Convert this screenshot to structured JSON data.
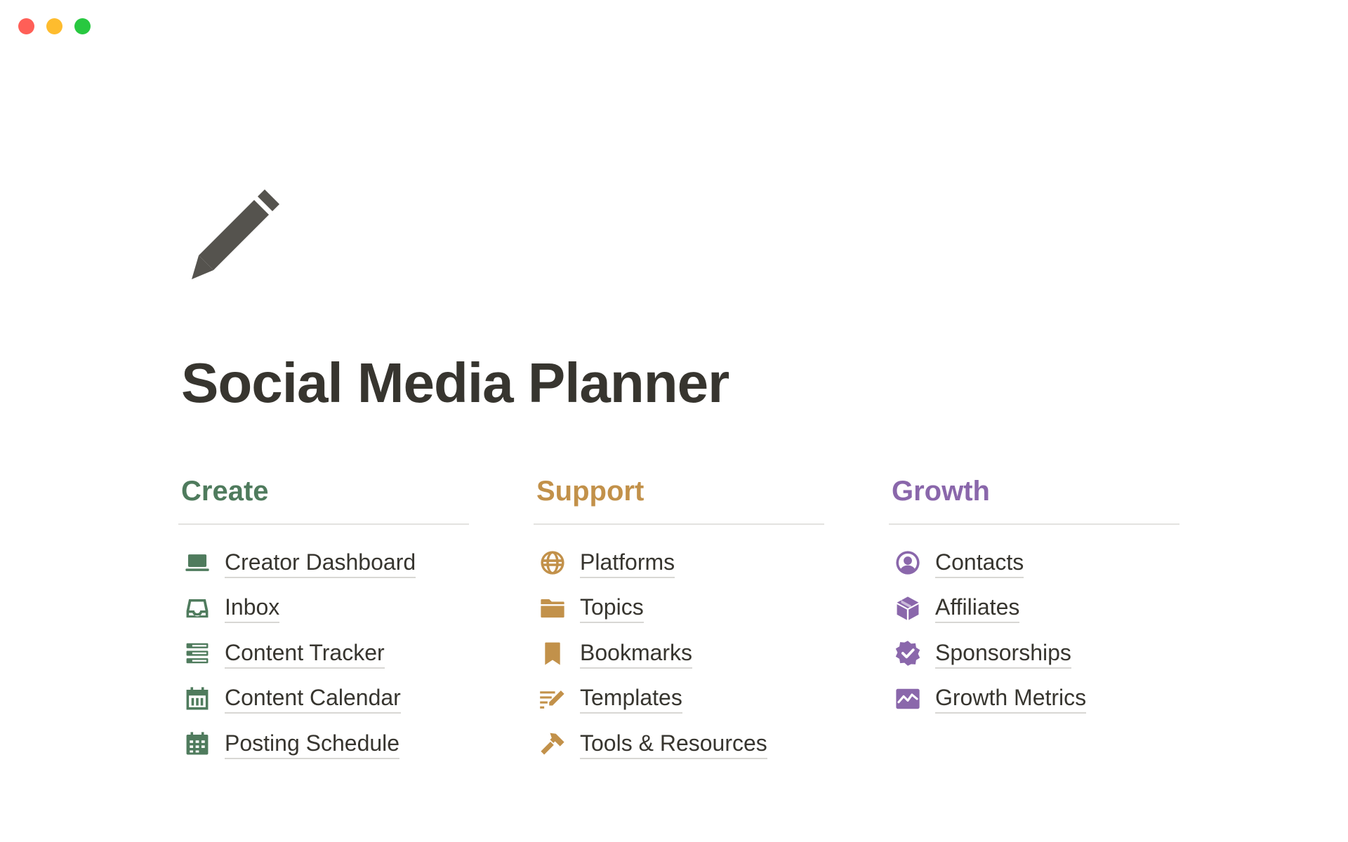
{
  "window": {
    "traffic_lights": [
      {
        "name": "close",
        "color": "#ff5f57"
      },
      {
        "name": "minimize",
        "color": "#febc2e"
      },
      {
        "name": "zoom",
        "color": "#28c840"
      }
    ]
  },
  "page": {
    "icon": "pencil-icon",
    "icon_color": "#55534e",
    "title": "Social Media Planner"
  },
  "columns": [
    {
      "heading": "Create",
      "color": "#4f7b5d",
      "items": [
        {
          "label": "Creator Dashboard",
          "icon": "laptop-icon"
        },
        {
          "label": "Inbox",
          "icon": "inbox-icon"
        },
        {
          "label": "Content Tracker",
          "icon": "database-icon"
        },
        {
          "label": "Content Calendar",
          "icon": "calendar-icon"
        },
        {
          "label": "Posting Schedule",
          "icon": "calendar-grid-icon"
        }
      ]
    },
    {
      "heading": "Support",
      "color": "#c2914a",
      "items": [
        {
          "label": "Platforms",
          "icon": "globe-icon"
        },
        {
          "label": "Topics",
          "icon": "folder-icon"
        },
        {
          "label": "Bookmarks",
          "icon": "bookmark-icon"
        },
        {
          "label": "Templates",
          "icon": "list-edit-icon"
        },
        {
          "label": "Tools & Resources",
          "icon": "hammer-icon"
        }
      ]
    },
    {
      "heading": "Growth",
      "color": "#8a67ab",
      "items": [
        {
          "label": "Contacts",
          "icon": "user-circle-icon"
        },
        {
          "label": "Affiliates",
          "icon": "box-icon"
        },
        {
          "label": "Sponsorships",
          "icon": "verified-badge-icon"
        },
        {
          "label": "Growth Metrics",
          "icon": "chart-line-icon"
        }
      ]
    }
  ]
}
